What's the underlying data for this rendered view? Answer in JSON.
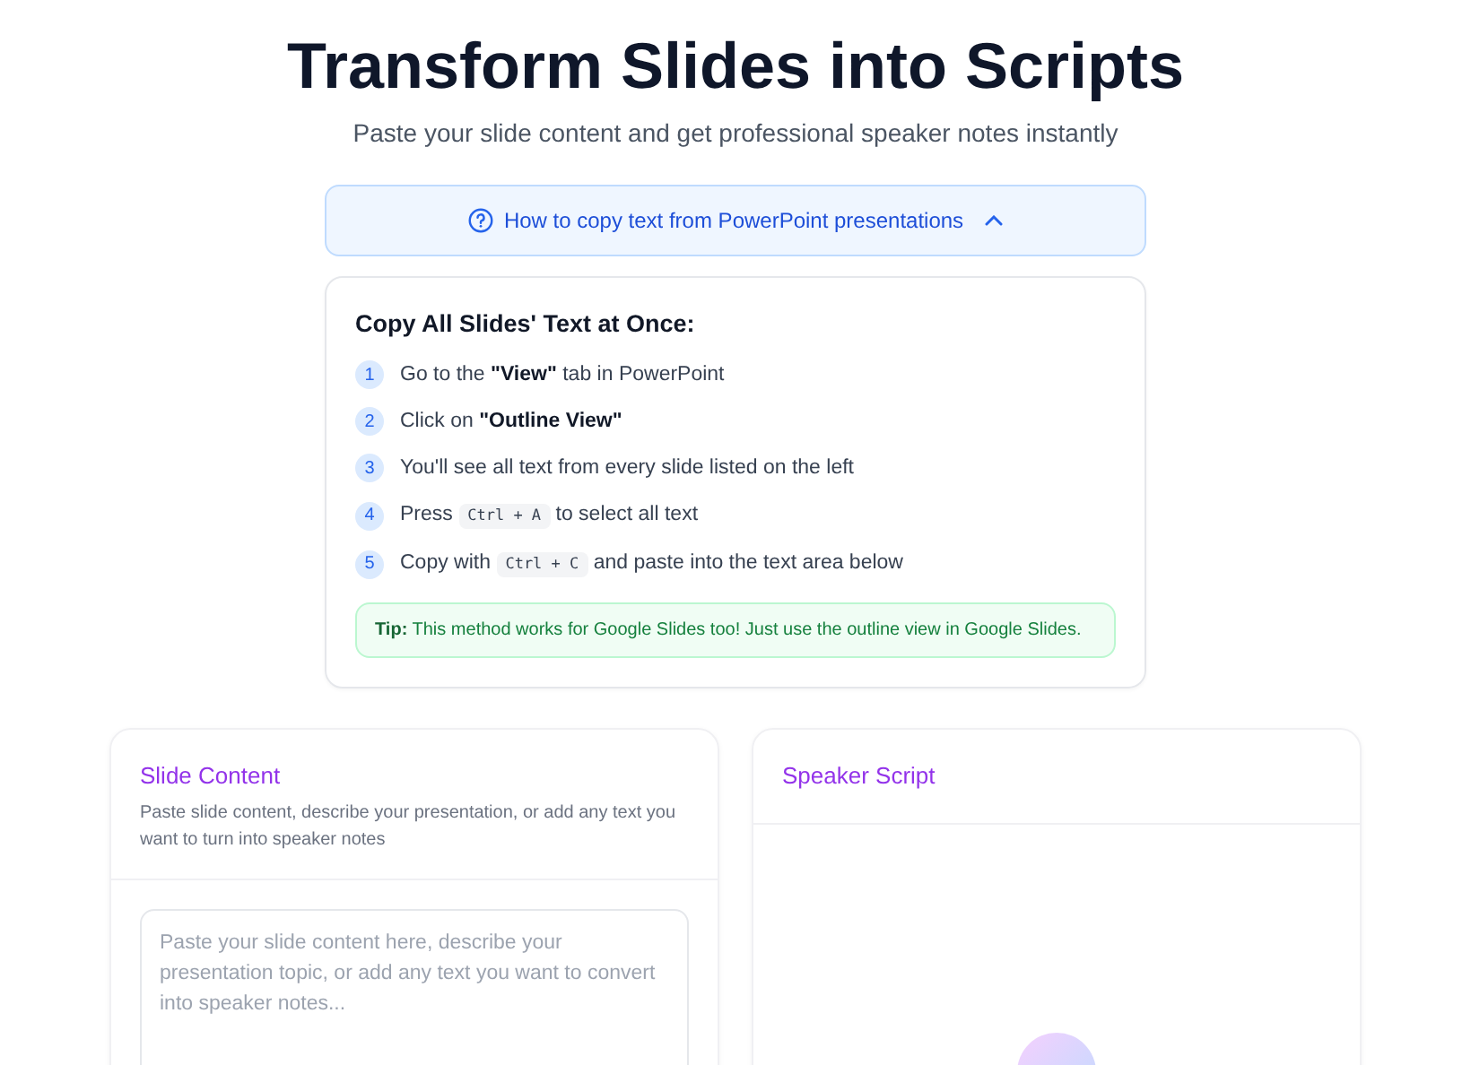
{
  "header": {
    "title": "Transform Slides into Scripts",
    "subtitle": "Paste your slide content and get professional speaker notes instantly"
  },
  "help_toggle": {
    "label": "How to copy text from PowerPoint presentations",
    "expanded": true
  },
  "instructions": {
    "heading": "Copy All Slides' Text at Once:",
    "steps": [
      {
        "number": "1",
        "parts": [
          {
            "kind": "text",
            "text": "Go to the **\"View\"** tab in PowerPoint"
          }
        ]
      },
      {
        "number": "2",
        "parts": [
          {
            "kind": "text",
            "text": "Click on **\"Outline View\"**"
          }
        ]
      },
      {
        "number": "3",
        "parts": [
          {
            "kind": "text",
            "text": "You'll see all text from every slide listed on the left"
          }
        ]
      },
      {
        "number": "4",
        "parts": [
          {
            "kind": "text",
            "text": "Press"
          },
          {
            "kind": "key",
            "text": "Ctrl + A"
          },
          {
            "kind": "text",
            "text": "to select all text"
          }
        ]
      },
      {
        "number": "5",
        "parts": [
          {
            "kind": "text",
            "text": "Copy with"
          },
          {
            "kind": "key",
            "text": "Ctrl + C"
          },
          {
            "kind": "text",
            "text": "and paste into the text area below"
          }
        ]
      }
    ],
    "tip": "**Tip:** This method works for Google Slides too! Just use the outline view in Google Slides."
  },
  "input_panel": {
    "title": "Slide Content",
    "description": "Paste slide content, describe your presentation, or add any text you want to turn into speaker notes",
    "placeholder": "Paste your slide content here, describe your presentation topic, or add any text you want to convert into speaker notes..."
  },
  "output_panel": {
    "title": "Speaker Script"
  }
}
